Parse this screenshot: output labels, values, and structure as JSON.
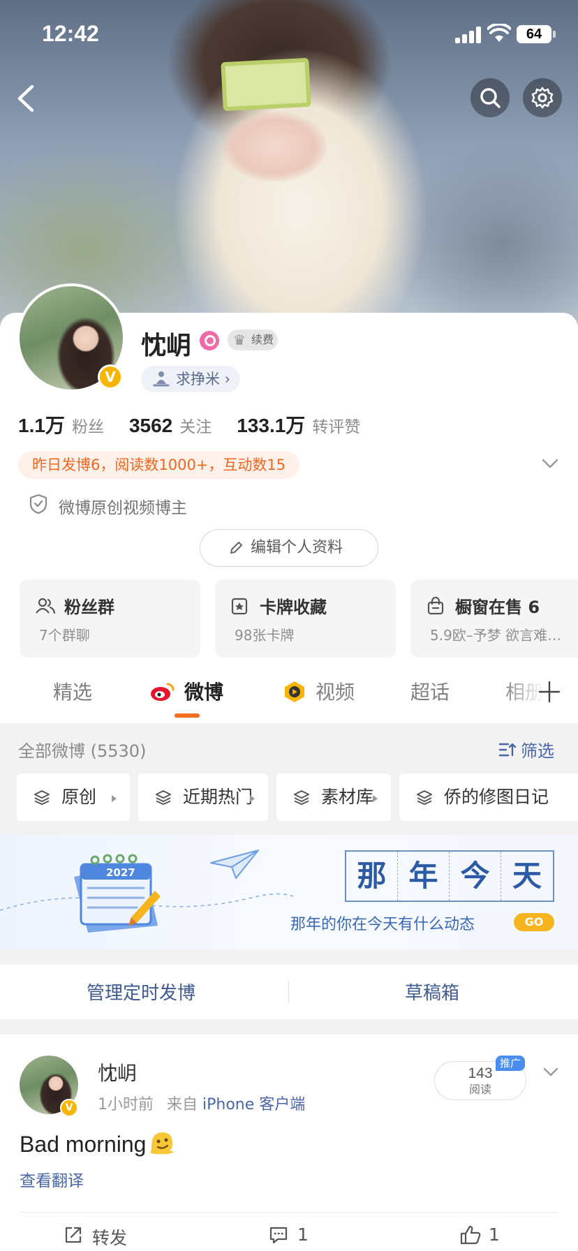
{
  "status": {
    "time": "12:42",
    "battery": "64"
  },
  "profile": {
    "name": "忱岄",
    "vip_badge": "续费",
    "tag": "求挣米 ›",
    "stats": [
      {
        "num": "1.1万",
        "label": "粉丝"
      },
      {
        "num": "3562",
        "label": "关注"
      },
      {
        "num": "133.1万",
        "label": "转评赞"
      }
    ],
    "notice": "昨日发博6，阅读数1000+，互动数15",
    "cert": "微博原创视频博主",
    "edit_label": "编辑个人资料"
  },
  "tiles": [
    {
      "title": "粉丝群",
      "sub": "7个群聊"
    },
    {
      "title": "卡牌收藏",
      "sub": "98张卡牌"
    },
    {
      "title": "橱窗在售 6",
      "sub": "5.9欧–予梦 欲言难…"
    }
  ],
  "tabs": [
    "精选",
    "微博",
    "视频",
    "超话",
    "相册"
  ],
  "feed": {
    "all_count": "全部微博 (5530)",
    "filter": "筛选",
    "chips": [
      "原创",
      "近期热门",
      "素材库",
      "侨的修图日记"
    ]
  },
  "memory": {
    "title": [
      "那",
      "年",
      "今",
      "天"
    ],
    "sub": "那年的你在今天有什么动态",
    "go": "GO",
    "year": "2027"
  },
  "manage": {
    "scheduled": "管理定时发博",
    "drafts": "草稿箱"
  },
  "post": {
    "author": "忱岄",
    "time": "1小时前",
    "from": "来自",
    "source": "iPhone 客户端",
    "reads_num": "143",
    "reads_label": "阅读",
    "promo": "推广",
    "text": "Bad morning",
    "translate": "查看翻译",
    "repost": "转发",
    "comments": "1",
    "likes": "1"
  }
}
